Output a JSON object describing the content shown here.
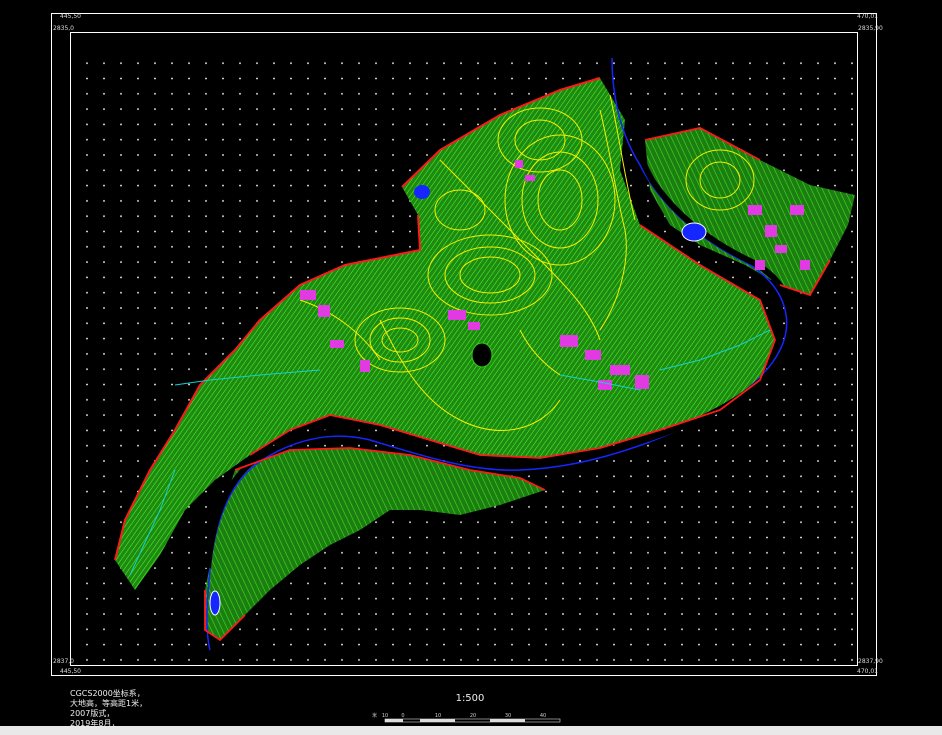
{
  "frame": {
    "corner_tl_top": "445,50",
    "corner_tl_side": "2835,0",
    "corner_tr_top": "470,01",
    "corner_tr_side": "2835,90",
    "corner_bl_top": "2837,0",
    "corner_bl_bottom": "445,50",
    "corner_br_top": "2837,90",
    "corner_br_bottom": "470,01"
  },
  "info": {
    "crs": "CGCS2000坐标系，",
    "datum": "大地高，等高距1米，",
    "spec": "2007版式，",
    "date": "2019年8月，"
  },
  "scale": {
    "ratio": "1:500",
    "unit": "米",
    "ticks": [
      "10",
      "0",
      "10",
      "20",
      "30",
      "40"
    ]
  },
  "map": {
    "background_color": "#000000",
    "grid_dot_color": "#ffffff",
    "vegetation_color": "#2ccf14",
    "contour_color": "#f4f000",
    "boundary_color": "#ff1a1a",
    "river_color": "#1626ff",
    "building_color": "#e23ae2",
    "road_color": "#16d0d0"
  }
}
